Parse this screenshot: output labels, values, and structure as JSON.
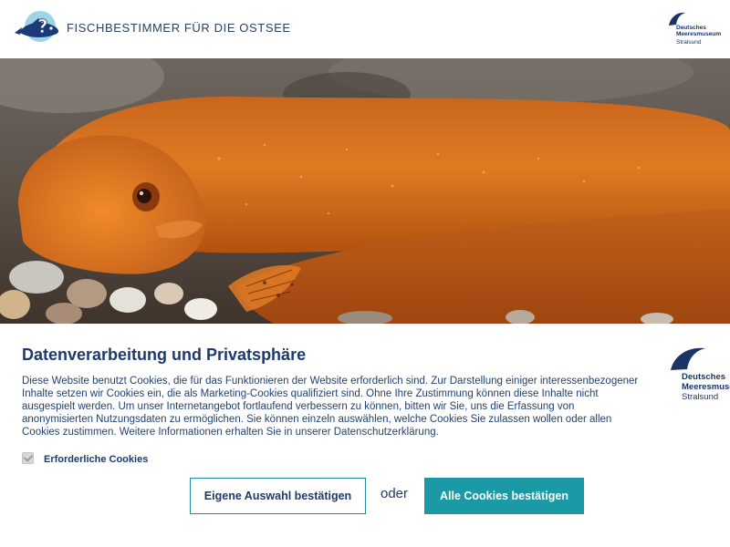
{
  "header": {
    "title": "FISCHBESTIMMER FÜR DIE OSTSEE",
    "logo_icon": "fish-question-mark-icon"
  },
  "brand": {
    "line1": "Deutsches",
    "line2": "Meeresmuseum",
    "line3": "Stralsund",
    "logo_icon": "meeresmuseum-wave-icon",
    "color": "#1a3466"
  },
  "hero": {
    "subject": "orange-fish-photo"
  },
  "cookie_panel": {
    "title": "Datenverarbeitung und Privatsphäre",
    "text": "Diese Website benutzt Cookies, die für das Funktionieren der Website erforderlich sind. Zur Darstellung einiger interessenbezogener Inhalte setzen wir Cookies ein, die als Marketing-Cookies qualifiziert sind. Ohne Ihre Zustimmung können diese Inhalte nicht ausgespielt werden. Um unser Internetangebot fortlaufend verbessern zu können, bitten wir Sie, uns die Erfassung von anonymisierten Nutzungsdaten zu ermöglichen. Sie können einzeln auswählen, welche Cookies Sie zulassen wollen oder allen Cookies zustimmen. Weitere Informationen erhalten Sie in unserer Datenschutzerklärung.",
    "required_cookies": {
      "label": "Erforderliche Cookies",
      "checked": true,
      "disabled": true
    },
    "own_selection_button": "Eigene Auswahl bestätigen",
    "separator": "oder",
    "accept_all_button": "Alle Cookies bestätigen",
    "accent_color": "#1b9aa5",
    "text_color": "#1d3a6e"
  }
}
